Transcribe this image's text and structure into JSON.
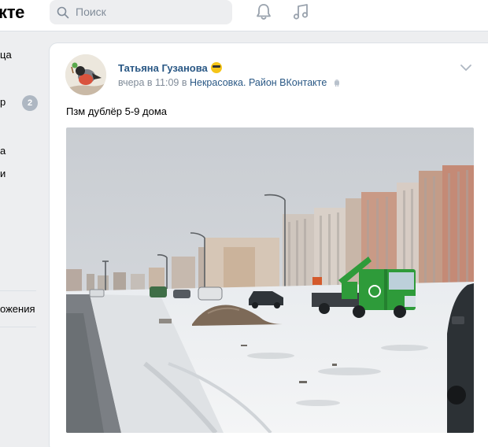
{
  "header": {
    "logo_text": "кте",
    "search_placeholder": "Поиск",
    "bell_icon": "bell-icon",
    "music_icon": "music-icon"
  },
  "sidebar": {
    "items": [
      {
        "label": "ца"
      },
      {
        "label": "р",
        "badge": "2"
      },
      {
        "label": "а"
      },
      {
        "label": "и"
      },
      {
        "label": "ожения"
      }
    ]
  },
  "post": {
    "author": "Татьяна Гузанова",
    "time": "вчера в 11:09 в",
    "source": "Некрасовка. Район ВКонтакте",
    "text": "Пзм дублёр 5-9 дома",
    "menu_icon": "chevron-down-icon"
  },
  "colors": {
    "link": "#2a5885",
    "muted": "#818c99",
    "background": "#edeef0",
    "truck_green": "#2e9b3a"
  }
}
